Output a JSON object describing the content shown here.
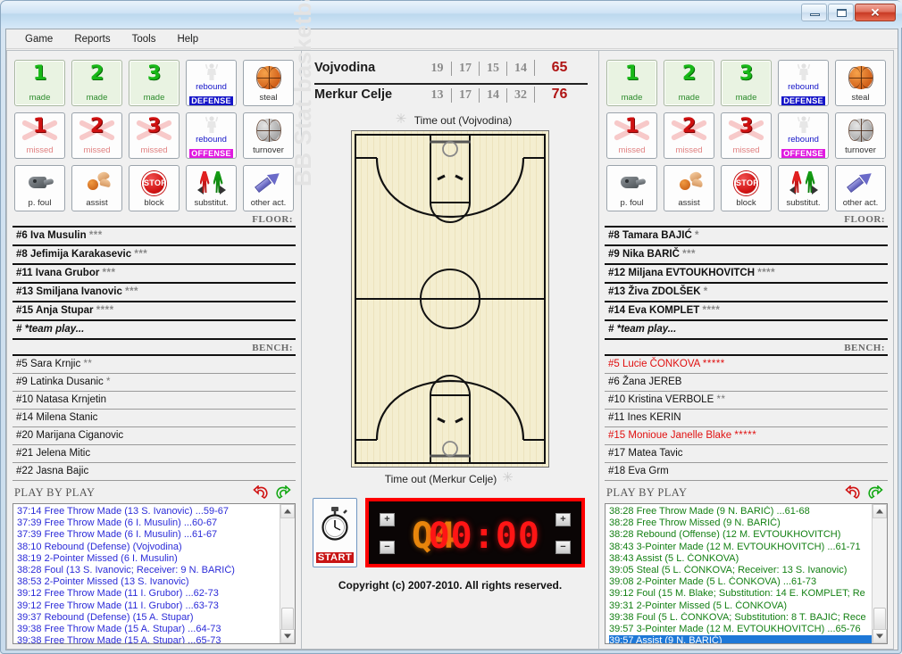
{
  "window": {
    "minimize_label": "",
    "maximize_label": "",
    "close_label": "✕"
  },
  "menu": {
    "items": [
      {
        "label": "Game"
      },
      {
        "label": "Reports"
      },
      {
        "label": "Tools"
      },
      {
        "label": "Help"
      }
    ]
  },
  "brand": {
    "vertical_text": "BB Stat basketball software",
    "copyright": "Copyright (c) 2007-2010. All rights reserved."
  },
  "scoreboard": {
    "rows": [
      {
        "team": "Vojvodina",
        "quarters": [
          "19",
          "17",
          "15",
          "14"
        ],
        "total": "65"
      },
      {
        "team": "Merkur Celje",
        "quarters": [
          "13",
          "17",
          "14",
          "32"
        ],
        "total": "76"
      }
    ],
    "total_color": "#b01414"
  },
  "timeouts": {
    "top": "Time out (Vojvodina)",
    "bottom": "Time out (Merkur Celje)"
  },
  "clock": {
    "quarter": "Q4",
    "time": "00:00",
    "start_label": "START",
    "plus_label": "+",
    "minus_label": "−"
  },
  "actions": {
    "buttons": [
      {
        "kind": "made",
        "num": "1",
        "caption": "made"
      },
      {
        "kind": "made",
        "num": "2",
        "caption": "made"
      },
      {
        "kind": "made",
        "num": "3",
        "caption": "made"
      },
      {
        "kind": "rebound-def",
        "word": "rebound",
        "tag": "DEFENSE",
        "caption": ""
      },
      {
        "kind": "icon-steal",
        "caption": "steal"
      },
      {
        "kind": "miss",
        "num": "1",
        "caption": "missed"
      },
      {
        "kind": "miss",
        "num": "2",
        "caption": "missed"
      },
      {
        "kind": "miss",
        "num": "3",
        "caption": "missed"
      },
      {
        "kind": "rebound-off",
        "word": "rebound",
        "tag": "OFFENSE",
        "caption": ""
      },
      {
        "kind": "icon-turnover",
        "caption": "turnover"
      },
      {
        "kind": "icon-foul",
        "caption": "p. foul"
      },
      {
        "kind": "icon-assist",
        "caption": "assist"
      },
      {
        "kind": "icon-block",
        "caption": "block",
        "sign": "STOP"
      },
      {
        "kind": "icon-sub",
        "caption": "substitut."
      },
      {
        "kind": "icon-other",
        "caption": "other act."
      }
    ]
  },
  "labels": {
    "floor": "FLOOR:",
    "bench": "BENCH:",
    "play_by_play": "PLAY BY PLAY",
    "undo_icon": "undo-icon",
    "redo_icon": "redo-icon"
  },
  "home": {
    "floor": [
      {
        "name": "#6 Iva Musulin",
        "stars": "***"
      },
      {
        "name": "#8 Jefimija Karakasevic",
        "stars": "***"
      },
      {
        "name": "#11 Ivana Grubor",
        "stars": "***"
      },
      {
        "name": "#13 Smiljana Ivanovic",
        "stars": "***"
      },
      {
        "name": "#15 Anja Stupar",
        "stars": "****"
      },
      {
        "name": "#  *team play...",
        "stars": "",
        "teamplay": true
      }
    ],
    "bench": [
      {
        "name": "#5 Sara Krnjic",
        "stars": "**"
      },
      {
        "name": "#9 Latinka Dusanic",
        "stars": "*"
      },
      {
        "name": "#10 Natasa Krnjetin",
        "stars": ""
      },
      {
        "name": "#14 Milena Stanic",
        "stars": ""
      },
      {
        "name": "#20 Marijana Ciganovic",
        "stars": ""
      },
      {
        "name": "#21 Jelena Mitic",
        "stars": ""
      },
      {
        "name": "#22 Jasna Bajic",
        "stars": ""
      }
    ],
    "playbyplay": [
      {
        "text": "37:14 Free Throw Made (13 S. Ivanovic) ...59-67"
      },
      {
        "text": "37:39 Free Throw Made (6 I. Musulin) ...60-67"
      },
      {
        "text": "37:39 Free Throw Made (6 I. Musulin) ...61-67"
      },
      {
        "text": "38:10 Rebound (Defense) (Vojvodina)"
      },
      {
        "text": "38:19 2-Pointer Missed (6 I. Musulin)"
      },
      {
        "text": "38:28 Foul (13 S. Ivanovic; Receiver: 9 N. BARIČ)"
      },
      {
        "text": "38:53 2-Pointer Missed (13 S. Ivanovic)"
      },
      {
        "text": "39:12 Free Throw Made (11 I. Grubor) ...62-73"
      },
      {
        "text": "39:12 Free Throw Made (11 I. Grubor) ...63-73"
      },
      {
        "text": "39:37 Rebound (Defense) (15 A. Stupar)"
      },
      {
        "text": "39:38 Free Throw Made (15 A. Stupar) ...64-73"
      },
      {
        "text": "39:38 Free Throw Made (15 A. Stupar) ...65-73"
      }
    ]
  },
  "away": {
    "floor": [
      {
        "name": "#8 Tamara BAJIĆ",
        "stars": "*"
      },
      {
        "name": "#9 Nika BARIČ",
        "stars": "***"
      },
      {
        "name": "#12 Miljana EVTOUKHOVITCH",
        "stars": "****"
      },
      {
        "name": "#13 Živa ZDOLŠEK",
        "stars": "*"
      },
      {
        "name": "#14 Eva KOMPLET",
        "stars": "****"
      },
      {
        "name": "#  *team play...",
        "stars": "",
        "teamplay": true
      }
    ],
    "bench": [
      {
        "name": "#5 Lucie ČONKOVA",
        "stars": "*****",
        "red": true
      },
      {
        "name": "#6 Žana JEREB",
        "stars": ""
      },
      {
        "name": "#10 Kristina VERBOLE",
        "stars": "**"
      },
      {
        "name": "#11 Ines KERIN",
        "stars": ""
      },
      {
        "name": "#15 Monioue Janelle Blake",
        "stars": "*****",
        "red": true
      },
      {
        "name": "#17 Matea Tavic",
        "stars": ""
      },
      {
        "name": "#18 Eva Grm",
        "stars": ""
      }
    ],
    "playbyplay": [
      {
        "text": "38:28 Free Throw Made (9 N. BARIČ) ...61-68"
      },
      {
        "text": "38:28 Free Throw Missed (9 N. BARIČ)"
      },
      {
        "text": "38:28 Rebound (Offense) (12 M. EVTOUKHOVITCH)"
      },
      {
        "text": "38:43 3-Pointer Made (12 M. EVTOUKHOVITCH) ...61-71"
      },
      {
        "text": "38:43 Assist (5 L. ČONKOVA)"
      },
      {
        "text": "39:05 Steal (5 L. ČONKOVA; Receiver: 13 S. Ivanovic)"
      },
      {
        "text": "39:08 2-Pointer Made (5 L. ČONKOVA) ...61-73"
      },
      {
        "text": "39:12 Foul (15 M. Blake; Substitution: 14 E. KOMPLET; Re"
      },
      {
        "text": "39:31 2-Pointer Missed (5 L. ČONKOVA)"
      },
      {
        "text": "39:38 Foul (5 L. ČONKOVA; Substitution: 8 T. BAJIĆ; Rece"
      },
      {
        "text": "39:57 3-Pointer Made (12 M. EVTOUKHOVITCH) ...65-76"
      },
      {
        "text": "39:57 Assist (9 N. BARIČ)",
        "selected": true
      }
    ]
  }
}
